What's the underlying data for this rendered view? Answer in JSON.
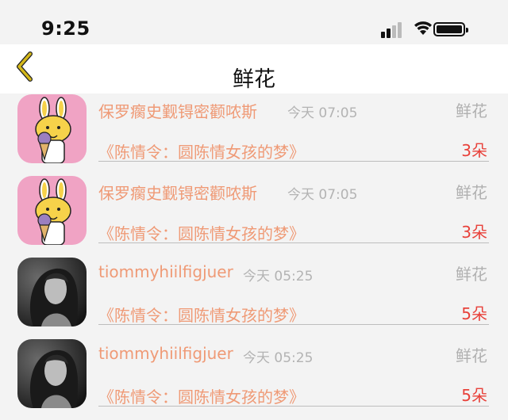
{
  "status": {
    "time": "9:25"
  },
  "nav": {
    "title": "鲜花",
    "back_icon": "chevron-left-icon"
  },
  "colors": {
    "accent": "#ef9a76",
    "count": "#e8413a",
    "muted": "#b0b0b0",
    "back": "#d4b81a"
  },
  "items": [
    {
      "avatar": "bunny-ice-cream-avatar",
      "name": "保罗瘸史觐锝密颧哝斯",
      "time": "今天 07:05",
      "type": "鲜花",
      "gift": "《陈情令：圆陈情女孩的梦》",
      "count": "3朵"
    },
    {
      "avatar": "bunny-ice-cream-avatar",
      "name": "保罗瘸史觐锝密颧哝斯",
      "time": "今天 07:05",
      "type": "鲜花",
      "gift": "《陈情令：圆陈情女孩的梦》",
      "count": "3朵"
    },
    {
      "avatar": "woman-portrait-avatar",
      "name": "tiommyhiilfigjuer",
      "time": "今天 05:25",
      "type": "鲜花",
      "gift": "《陈情令：圆陈情女孩的梦》",
      "count": "5朵"
    },
    {
      "avatar": "woman-portrait-avatar",
      "name": "tiommyhiilfigjuer",
      "time": "今天 05:25",
      "type": "鲜花",
      "gift": "《陈情令：圆陈情女孩的梦》",
      "count": "5朵"
    }
  ]
}
